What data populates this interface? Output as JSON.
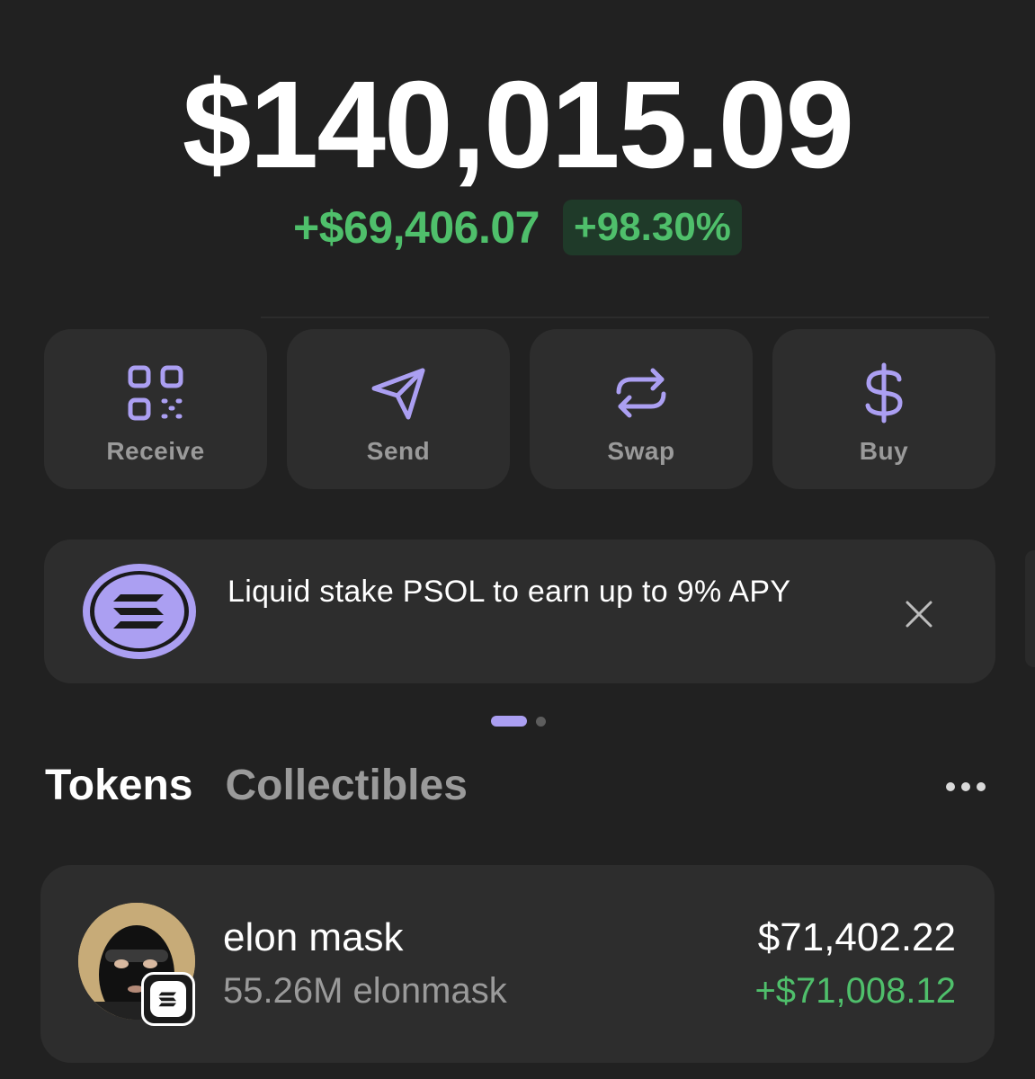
{
  "portfolio": {
    "balance": "$140,015.09",
    "change_amount": "+$69,406.07",
    "change_percent": "+98.30%"
  },
  "actions": {
    "receive": {
      "label": "Receive",
      "icon": "qr-code-icon"
    },
    "send": {
      "label": "Send",
      "icon": "paper-plane-icon"
    },
    "swap": {
      "label": "Swap",
      "icon": "swap-arrows-icon"
    },
    "buy": {
      "label": "Buy",
      "icon": "dollar-icon"
    }
  },
  "promo": {
    "text": "Liquid stake PSOL to earn up to 9% APY",
    "icon": "solana-logo-icon"
  },
  "carousel": {
    "active_index": 0,
    "count": 2
  },
  "tabs": {
    "tokens": "Tokens",
    "collectibles": "Collectibles",
    "active": "tokens"
  },
  "tokens": [
    {
      "name": "elon mask",
      "amount": "55.26M elonmask",
      "value": "$71,402.22",
      "change": "+$71,008.12"
    }
  ],
  "colors": {
    "background": "#212121",
    "card": "#2d2d2d",
    "accent": "#ab9ff2",
    "positive": "#4fbf6b"
  }
}
